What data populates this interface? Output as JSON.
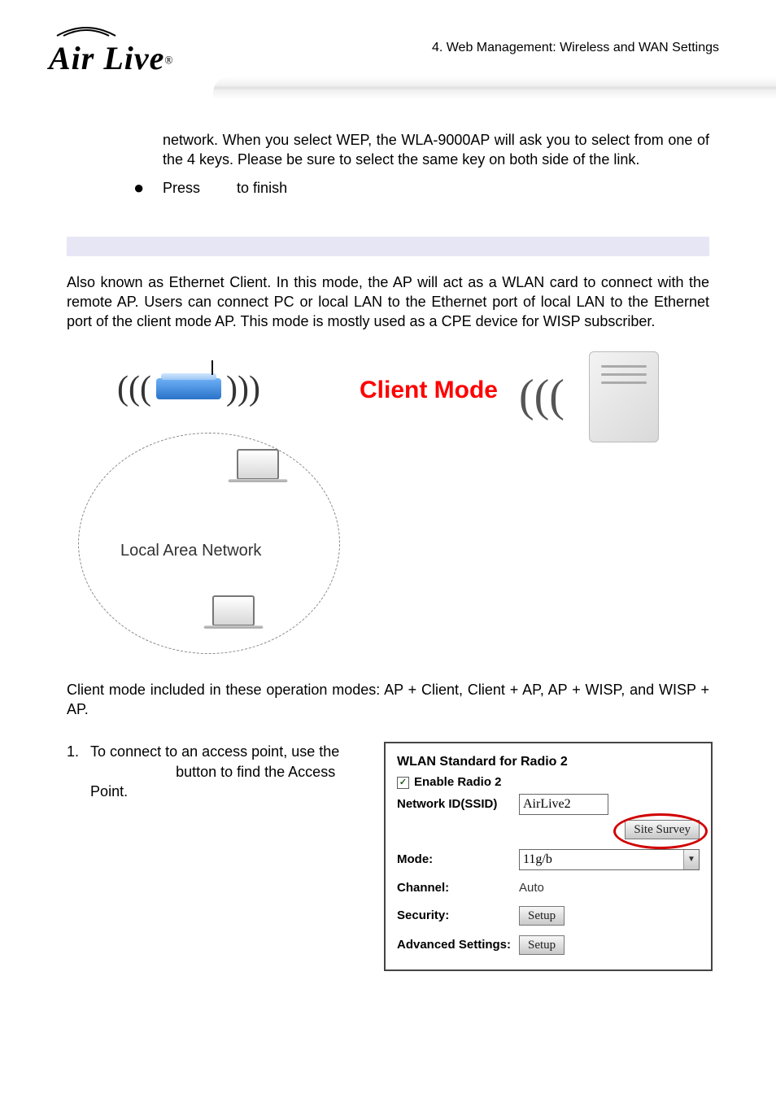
{
  "header": {
    "logo_text": "Air Live",
    "chapter": "4. Web Management: Wireless and WAN Settings"
  },
  "body": {
    "wep_para": "network.    When  you  select  WEP,  the  WLA-9000AP  will  ask  you  to  select from one of the 4 keys.    Please be sure to select the same key on both side of the link.",
    "press_prefix": "Press ",
    "press_suffix": " to finish",
    "client_intro": "Also known as Ethernet Client. In this mode, the AP will act as a WLAN card to connect with the remote AP. Users can connect PC or local LAN to the Ethernet port of local LAN to the Ethernet port of the client mode AP. This mode is mostly used as a CPE device for WISP subscriber.",
    "diagram": {
      "mode_label": "Client Mode",
      "lan_label": "Local Area Network"
    },
    "client_modes_para": "Client mode included in these operation modes: AP + Client, Client + AP, AP + WISP, and WISP + AP.",
    "step1_num": "1.",
    "step1_line1": "To connect to an access point, use the",
    "step1_line2": " button to find the Access Point."
  },
  "panel": {
    "title": "WLAN Standard for Radio 2",
    "enable_label": "Enable Radio 2",
    "enable_checked": "✓",
    "rows": {
      "ssid_label": "Network ID(SSID)",
      "ssid_value": "AirLive2",
      "site_survey_btn": "Site Survey",
      "mode_label": "Mode:",
      "mode_value": "11g/b",
      "channel_label": "Channel:",
      "channel_value": "Auto",
      "security_label": "Security:",
      "security_btn": "Setup",
      "adv_label": "Advanced Settings:",
      "adv_btn": "Setup"
    }
  }
}
